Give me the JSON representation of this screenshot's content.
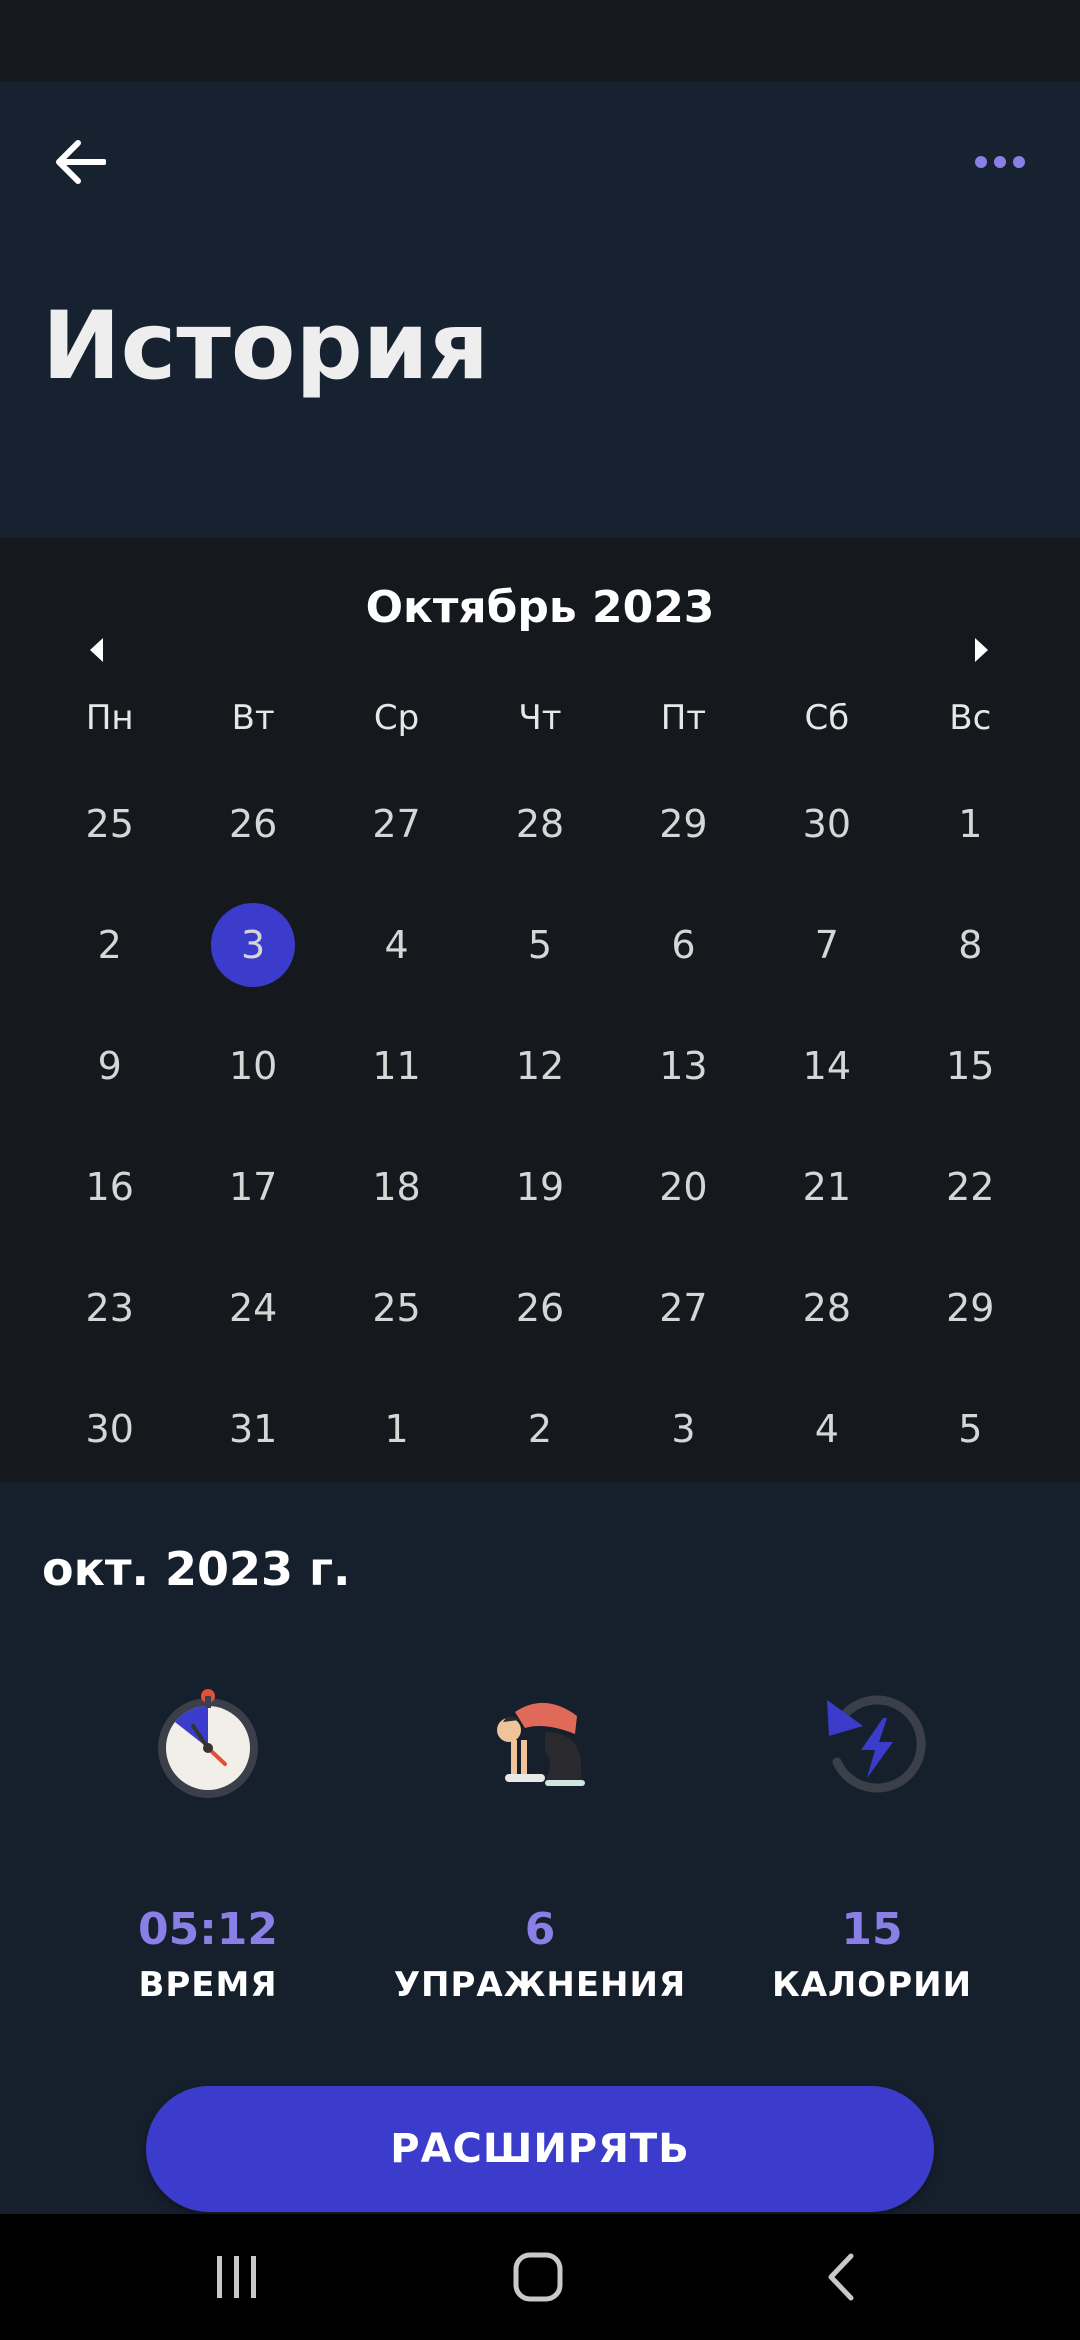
{
  "header": {
    "title": "История",
    "back_icon": "arrow-left-icon",
    "more_icon": "more-horizontal-icon",
    "accent": "#8a7fe6"
  },
  "calendar": {
    "month_label": "Октябрь 2023",
    "weekdays": [
      "Пн",
      "Вт",
      "Ср",
      "Чт",
      "Пт",
      "Сб",
      "Вс"
    ],
    "days": [
      "25",
      "26",
      "27",
      "28",
      "29",
      "30",
      "1",
      "2",
      "3",
      "4",
      "5",
      "6",
      "7",
      "8",
      "9",
      "10",
      "11",
      "12",
      "13",
      "14",
      "15",
      "16",
      "17",
      "18",
      "19",
      "20",
      "21",
      "22",
      "23",
      "24",
      "25",
      "26",
      "27",
      "28",
      "29",
      "30",
      "31",
      "1",
      "2",
      "3",
      "4",
      "5"
    ],
    "selected_day": "3",
    "selected_color": "#3c3ccc"
  },
  "summary": {
    "date_label": "окт. 2023 г.",
    "stats": [
      {
        "icon": "stopwatch-icon",
        "value": "05:12",
        "label": "ВРЕМЯ"
      },
      {
        "icon": "yoga-pose-icon",
        "value": "6",
        "label": "УПРАЖНЕНИЯ"
      },
      {
        "icon": "calorie-burn-icon",
        "value": "15",
        "label": "КАЛОРИИ"
      }
    ]
  },
  "expand_button": {
    "label": "РАСШИРЯТЬ",
    "color": "#3c3ccc"
  },
  "system_nav": {
    "recents_icon": "recents-icon",
    "home_icon": "home-icon",
    "back_icon": "back-chevron-icon"
  }
}
